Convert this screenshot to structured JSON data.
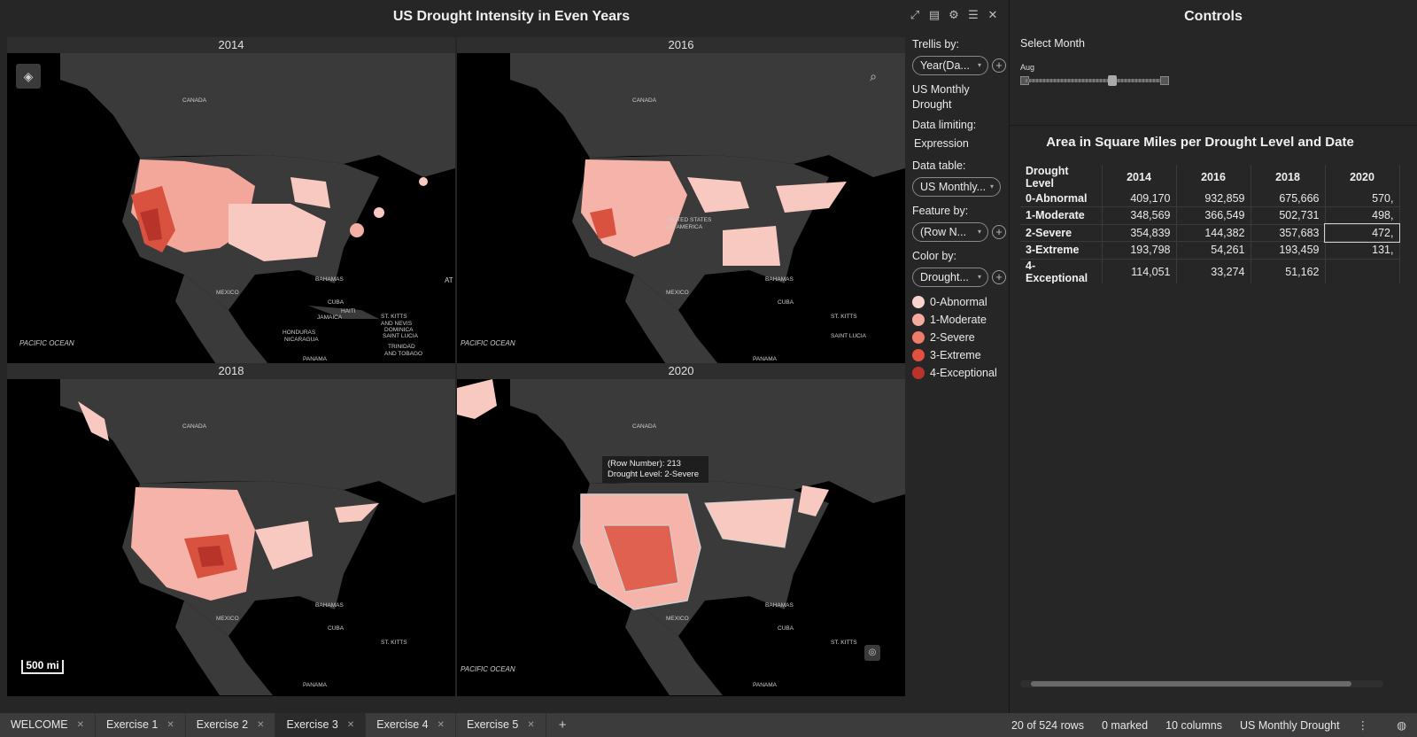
{
  "visualization": {
    "title": "US Drought Intensity in Even Years",
    "tools": [
      "expand-icon",
      "notes-icon",
      "settings-icon",
      "list-icon",
      "close-icon"
    ],
    "panels": [
      {
        "year": "2014"
      },
      {
        "year": "2016"
      },
      {
        "year": "2018"
      },
      {
        "year": "2020"
      }
    ],
    "map_labels": {
      "canada": "CANADA",
      "pacific": "PACIFIC OCEAN",
      "mexico": "MEXICO",
      "bahamas": "BAHAMAS",
      "cuba": "CUBA",
      "haiti": "HAITI",
      "jamaica": "JAMAICA",
      "honduras": "HONDURAS",
      "nicaragua": "NICARAGUA",
      "panama": "PANAMA",
      "st_kitts": "ST. KITTS",
      "dominica": "DOMINICA",
      "saint_lucia": "SAINT LUCIA",
      "trinidad": "TRINIDAD",
      "and_tobago": "AND TOBAGO",
      "and_nevis": "AND NEVIS",
      "usa": "UNITED STATES",
      "of_america": "OF AMERICA",
      "atlantic_a": "AT"
    },
    "scale": "500 mi",
    "tooltip": {
      "line1": "(Row Number): 213",
      "line2": "Drought Level: 2-Severe"
    }
  },
  "sidebar": {
    "trellis_label": "Trellis by:",
    "trellis_value": "Year(Da...",
    "dataset_name_line1": "US Monthly",
    "dataset_name_line2": "Drought",
    "data_limiting_label": "Data limiting:",
    "data_limiting_value": "Expression",
    "data_table_label": "Data table:",
    "data_table_value": "US Monthly...",
    "feature_label": "Feature by:",
    "feature_value": "(Row N...",
    "color_label": "Color by:",
    "color_value": "Drought...",
    "legend": [
      {
        "label": "0-Abnormal",
        "color": "#f9d4cf"
      },
      {
        "label": "1-Moderate",
        "color": "#f5aaa0"
      },
      {
        "label": "2-Severe",
        "color": "#ee7c6b"
      },
      {
        "label": "3-Extreme",
        "color": "#e0513f"
      },
      {
        "label": "4-Exceptional",
        "color": "#b8342a"
      }
    ]
  },
  "controls": {
    "title": "Controls",
    "select_month_label": "Select Month",
    "month_value": "Aug",
    "slider_fraction": 0.62,
    "table_title": "Area in Square Miles per Drought Level and Date",
    "table": {
      "columns": [
        "Drought Level",
        "2014",
        "2016",
        "2018",
        "2020"
      ],
      "rows": [
        [
          "0-Abnormal",
          "409,170",
          "932,859",
          "675,666",
          "570,"
        ],
        [
          "1-Moderate",
          "348,569",
          "366,549",
          "502,731",
          "498,"
        ],
        [
          "2-Severe",
          "354,839",
          "144,382",
          "357,683",
          "472,"
        ],
        [
          "3-Extreme",
          "193,798",
          "54,261",
          "193,459",
          "131,"
        ],
        [
          "4-Exceptional",
          "114,051",
          "33,274",
          "51,162",
          ""
        ]
      ]
    }
  },
  "tabs": [
    {
      "label": "WELCOME",
      "active": false
    },
    {
      "label": "Exercise 1",
      "active": false
    },
    {
      "label": "Exercise 2",
      "active": false
    },
    {
      "label": "Exercise 3",
      "active": true
    },
    {
      "label": "Exercise 4",
      "active": false
    },
    {
      "label": "Exercise 5",
      "active": false
    }
  ],
  "status": {
    "rows": "20 of 524 rows",
    "marked": "0 marked",
    "columns": "10 columns",
    "table": "US Monthly Drought"
  }
}
